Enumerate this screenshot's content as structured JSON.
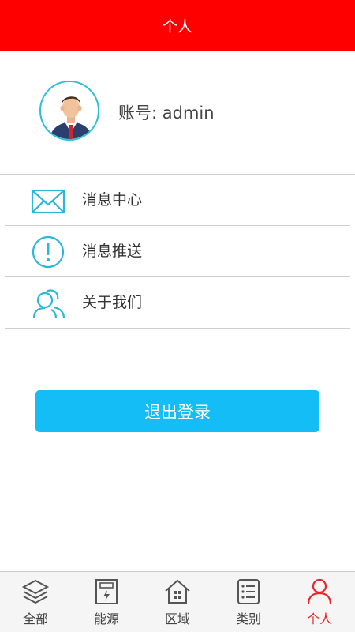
{
  "header": {
    "title": "个人"
  },
  "profile": {
    "account_text": "账号: admin"
  },
  "menu": [
    {
      "label": "消息中心",
      "icon": "mail-icon"
    },
    {
      "label": "消息推送",
      "icon": "exclamation-icon"
    },
    {
      "label": "关于我们",
      "icon": "people-icon"
    }
  ],
  "logout": {
    "label": "退出登录"
  },
  "tabbar": {
    "tabs": [
      {
        "label": "全部",
        "icon": "layers-icon"
      },
      {
        "label": "能源",
        "icon": "energy-meter-icon"
      },
      {
        "label": "区域",
        "icon": "house-icon"
      },
      {
        "label": "类别",
        "icon": "list-icon"
      },
      {
        "label": "个人",
        "icon": "person-icon"
      }
    ],
    "active_index": 4
  },
  "colors": {
    "header": "#fe0000",
    "accent": "#2cc0dd",
    "button": "#14bdf5",
    "active_tab": "#e8262c"
  }
}
